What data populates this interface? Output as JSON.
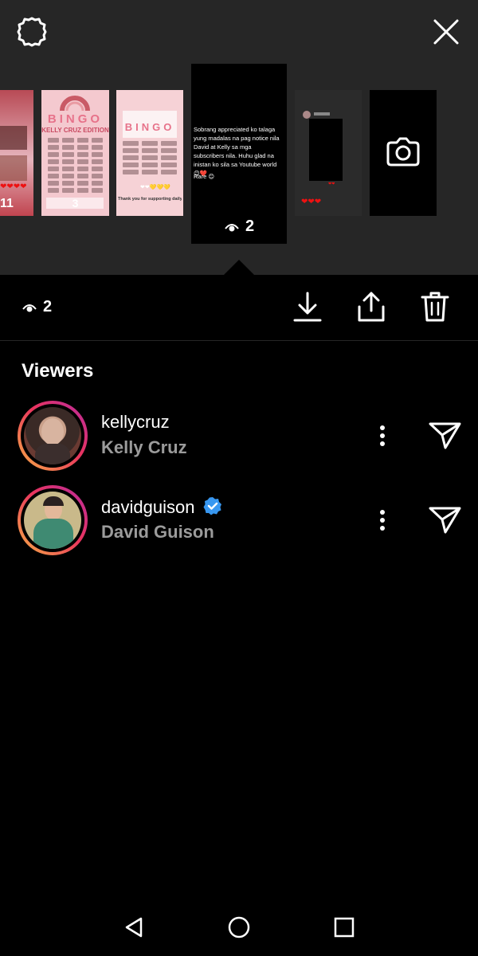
{
  "header": {
    "settings_icon": "gear-icon",
    "close_icon": "close-icon"
  },
  "stories": {
    "thumb1_count": "11",
    "thumb1_hearts": "❤❤❤❤",
    "thumb2_title": "BINGO",
    "thumb2_subtitle": "KELLY CRUZ EDITION",
    "thumb2_index": "3",
    "thumb3_title": "BINGO",
    "thumb3_footer": "Thank you for supporting daily live",
    "thumb3_hearts": "❤❤💛💛💛",
    "selected_caption": "Sobrang appreciated ko talaga yung madalas na pag notice nila David at Kelly sa mga subscribers nila. Huhu glad na inistan ko sila sa Youtube world 😊❤️",
    "selected_caption2": "Rare 😊",
    "selected_views": "2",
    "thumb5_hearts": "❤❤❤",
    "add_story_icon": "camera-icon"
  },
  "actions": {
    "view_count": "2",
    "download_icon": "download-icon",
    "share_icon": "share-icon",
    "delete_icon": "trash-icon"
  },
  "viewers": {
    "title": "Viewers",
    "items": [
      {
        "username": "kellycruz",
        "full_name": "Kelly Cruz",
        "verified": false
      },
      {
        "username": "davidguison",
        "full_name": "David Guison",
        "verified": true
      }
    ]
  },
  "colors": {
    "background": "#000000",
    "top_panel": "#262626",
    "secondary_text": "#9b9b9b",
    "verified_blue": "#3897f0"
  }
}
